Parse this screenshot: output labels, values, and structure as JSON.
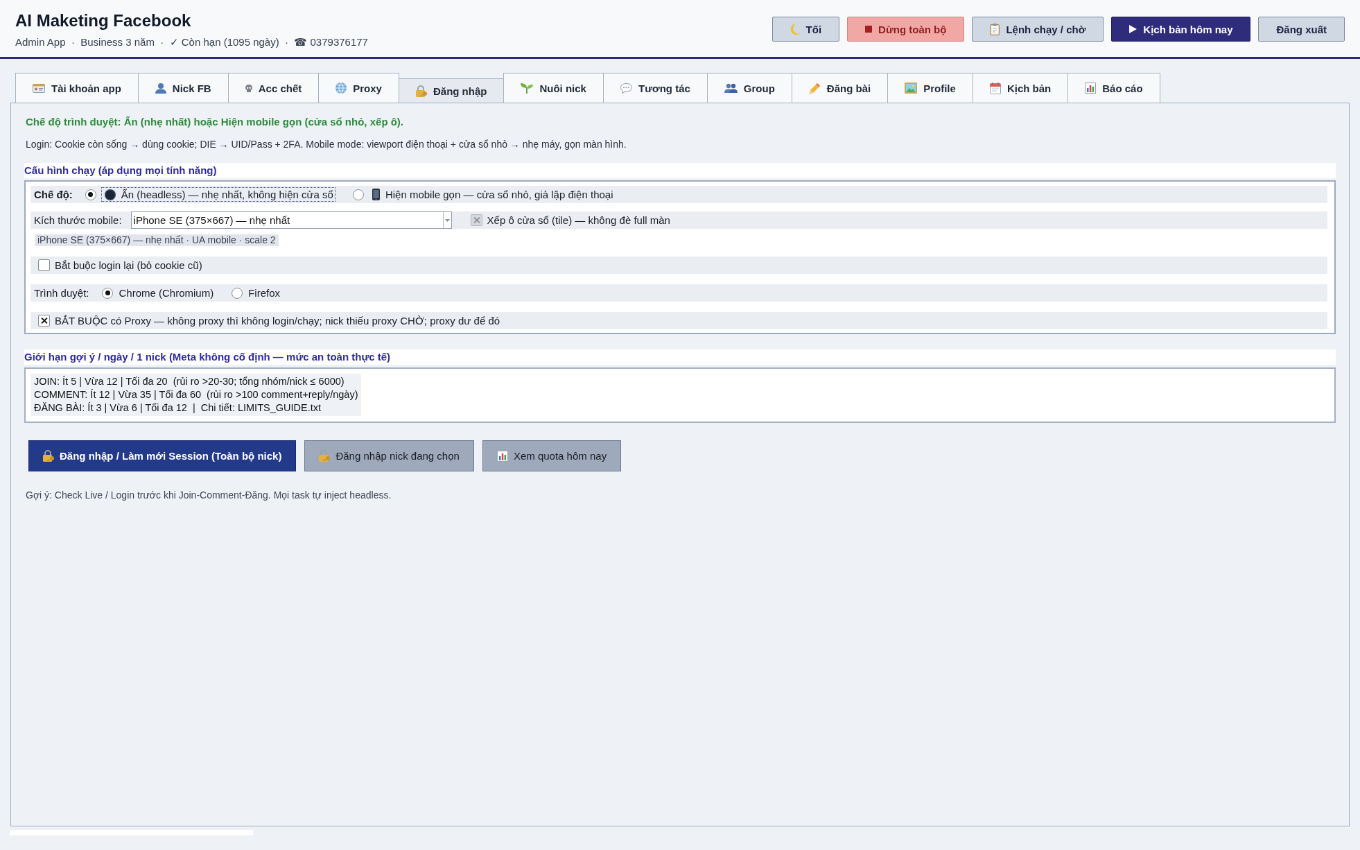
{
  "header": {
    "title": "AI Maketing Facebook",
    "subtitle": "Admin App  ·  Business 3 năm  ·  ✓ Còn hạn (1095 ngày)  ·  ☎ 0379376177",
    "buttons": [
      {
        "label": "Tối",
        "kind": "neutral"
      },
      {
        "label": "Dừng toàn bộ",
        "kind": "danger"
      },
      {
        "label": "Lệnh chạy / chờ",
        "kind": "neutral"
      },
      {
        "label": "Kịch bản hôm nay",
        "kind": "primary"
      },
      {
        "label": "Đăng xuất",
        "kind": "neutral"
      }
    ]
  },
  "tabs": [
    {
      "label": "Tài khoản app",
      "selected": false
    },
    {
      "label": "Nick FB",
      "selected": false
    },
    {
      "label": "Acc chết",
      "selected": false
    },
    {
      "label": "Proxy",
      "selected": false
    },
    {
      "label": "Đăng nhập",
      "selected": true
    },
    {
      "label": "Nuôi nick",
      "selected": false
    },
    {
      "label": "Tương tác",
      "selected": false
    },
    {
      "label": "Group",
      "selected": false
    },
    {
      "label": "Đăng bài",
      "selected": false
    },
    {
      "label": "Profile",
      "selected": false
    },
    {
      "label": "Kịch bản",
      "selected": false
    },
    {
      "label": "Báo cáo",
      "selected": false
    }
  ],
  "panel": {
    "notice": "Chế độ trình duyệt: Ẩn (nhẹ nhất) hoặc Hiện mobile gọn (cửa sổ nhỏ, xếp ô).",
    "description": "Login: Cookie còn sống → dùng cookie; DIE → UID/Pass + 2FA. Mobile mode: viewport điện thoại + cửa sổ nhỏ → nhẹ máy, gọn màn hình.",
    "run_config": {
      "title": "Cấu hình chạy (áp dụng mọi tính năng)",
      "mode": {
        "label": "Chế độ:",
        "options": [
          {
            "label": "Ẩn (headless) — nhẹ nhất, không hiện cửa sổ",
            "selected": true,
            "focused": true
          },
          {
            "label": "Hiện mobile gọn — cửa sổ nhỏ, giả lập điện thoại",
            "selected": false,
            "focused": false
          }
        ]
      },
      "mobile_size": {
        "label": "Kích thước mobile:",
        "value": "iPhone SE (375×667) — nhẹ nhất"
      },
      "tile": {
        "label": "Xếp ô cửa sổ (tile) — không đè full màn",
        "checked": true,
        "disabled": true
      },
      "size_info": "iPhone SE (375×667) — nhẹ nhất · UA mobile · scale 2",
      "force_relogin": {
        "label": "Bắt buộc login lại (bỏ cookie cũ)",
        "checked": false
      },
      "browser": {
        "label": "Trình duyệt:",
        "options": [
          {
            "label": "Chrome (Chromium)",
            "selected": true
          },
          {
            "label": "Firefox",
            "selected": false
          }
        ]
      },
      "require_proxy": {
        "label": "BẮT BUỘC có Proxy — không proxy thì không login/chạy; nick thiếu proxy CHỜ; proxy dư để đó",
        "checked": true
      }
    },
    "limits": {
      "title": "Giới hạn gợi ý / ngày / 1 nick (Meta không cố định — mức an toàn thực tế)",
      "lines": [
        "JOIN: Ít 5 | Vừa 12 | Tối đa 20  (rủi ro >20-30; tổng nhóm/nick ≤ 6000)",
        "COMMENT: Ít 12 | Vừa 35 | Tối đa 60  (rủi ro >100 comment+reply/ngày)",
        "ĐĂNG BÀI: Ít 3 | Vừa 6 | Tối đa 12  |  Chi tiết: LIMITS_GUIDE.txt"
      ]
    },
    "actions": [
      {
        "label": "Đăng nhập / Làm mới Session (Toàn bộ nick)",
        "kind": "primary"
      },
      {
        "label": "Đăng nhập nick đang chọn",
        "kind": "secondary"
      },
      {
        "label": "Xem quota hôm nay",
        "kind": "secondary"
      }
    ],
    "hint": "Gợi ý: Check Live / Login trước khi Join-Comment-Đăng. Mọi task tự inject headless."
  }
}
